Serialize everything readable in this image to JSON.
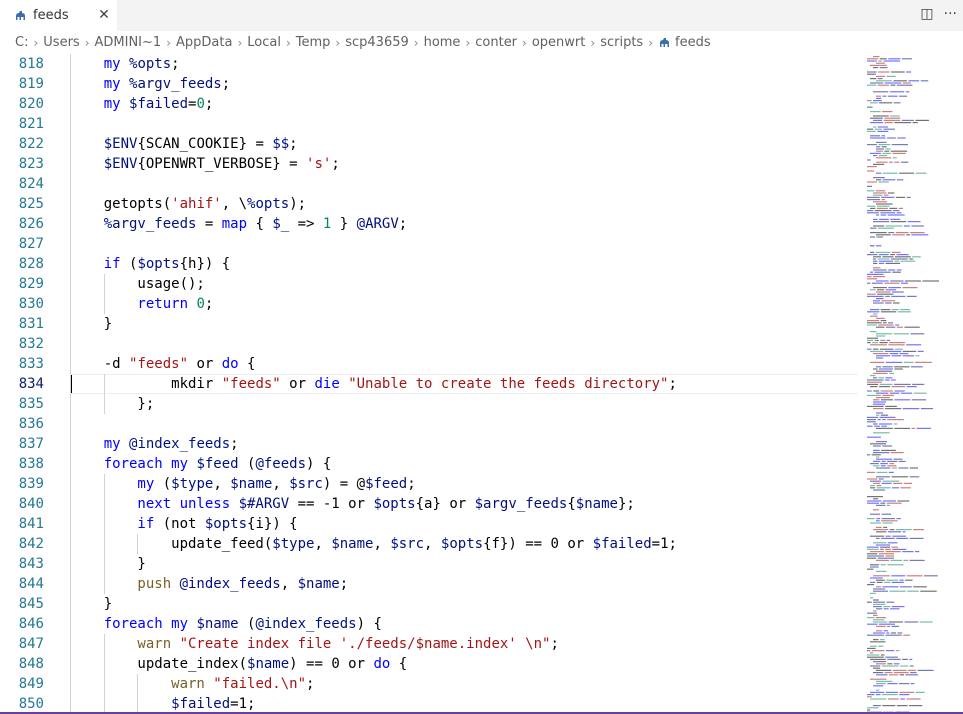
{
  "tab": {
    "label": "feeds",
    "close_glyph": "✕",
    "icon": "perl-camel-icon"
  },
  "actions": {
    "split_glyph": "◫",
    "more_glyph": "···"
  },
  "breadcrumb": [
    "C:",
    "Users",
    "ADMINI~1",
    "AppData",
    "Local",
    "Temp",
    "scp43659",
    "home",
    "conter",
    "openwrt",
    "scripts",
    "feeds"
  ],
  "breadcrumb_separator": "›",
  "cursor_line": 834,
  "lines": [
    {
      "n": "818",
      "t": [
        [
          "    my ",
          "kw"
        ],
        [
          "%opts",
          "var"
        ],
        [
          ";",
          "plain"
        ]
      ]
    },
    {
      "n": "819",
      "t": [
        [
          "    my ",
          "kw"
        ],
        [
          "%argv_feeds",
          "var"
        ],
        [
          ";",
          "plain"
        ]
      ]
    },
    {
      "n": "820",
      "t": [
        [
          "    my ",
          "kw"
        ],
        [
          "$failed",
          "var"
        ],
        [
          "=",
          "plain"
        ],
        [
          "0",
          "num"
        ],
        [
          ";",
          "plain"
        ]
      ]
    },
    {
      "n": "821",
      "t": []
    },
    {
      "n": "822",
      "t": [
        [
          "    $ENV",
          "var"
        ],
        [
          "{SCAN_COOKIE}",
          "plain"
        ],
        [
          " = ",
          "plain"
        ],
        [
          "$$",
          "var"
        ],
        [
          ";",
          "plain"
        ]
      ]
    },
    {
      "n": "823",
      "t": [
        [
          "    $ENV",
          "var"
        ],
        [
          "{OPENWRT_VERBOSE}",
          "plain"
        ],
        [
          " = ",
          "plain"
        ],
        [
          "'s'",
          "str"
        ],
        [
          ";",
          "plain"
        ]
      ]
    },
    {
      "n": "824",
      "t": []
    },
    {
      "n": "825",
      "t": [
        [
          "    getopts(",
          "plain"
        ],
        [
          "'ahif'",
          "str"
        ],
        [
          ", \\",
          "plain"
        ],
        [
          "%opts",
          "var"
        ],
        [
          ");",
          "plain"
        ]
      ]
    },
    {
      "n": "826",
      "t": [
        [
          "    %argv_feeds",
          "var"
        ],
        [
          " = ",
          "plain"
        ],
        [
          "map",
          "kw"
        ],
        [
          " { ",
          "plain"
        ],
        [
          "$_",
          "var"
        ],
        [
          " => ",
          "plain"
        ],
        [
          "1",
          "num"
        ],
        [
          " } ",
          "plain"
        ],
        [
          "@ARGV",
          "var"
        ],
        [
          ";",
          "plain"
        ]
      ]
    },
    {
      "n": "827",
      "t": []
    },
    {
      "n": "828",
      "t": [
        [
          "    if",
          "kw"
        ],
        [
          " (",
          "plain"
        ],
        [
          "$opts",
          "var"
        ],
        [
          "{h}",
          "plain"
        ],
        [
          ") {",
          "plain"
        ]
      ]
    },
    {
      "n": "829",
      "t": [
        [
          "        usage();",
          "plain"
        ]
      ]
    },
    {
      "n": "830",
      "t": [
        [
          "        return ",
          "kw"
        ],
        [
          "0",
          "num"
        ],
        [
          ";",
          "plain"
        ]
      ]
    },
    {
      "n": "831",
      "t": [
        [
          "    }",
          "plain"
        ]
      ]
    },
    {
      "n": "832",
      "t": []
    },
    {
      "n": "833",
      "t": [
        [
          "    -d ",
          "plain"
        ],
        [
          "\"feeds\"",
          "str"
        ],
        [
          " or ",
          "plain"
        ],
        [
          "do",
          "kw"
        ],
        [
          " {",
          "plain"
        ]
      ]
    },
    {
      "n": "834",
      "t": [
        [
          "            mkdir ",
          "plain"
        ],
        [
          "\"feeds\"",
          "str"
        ],
        [
          " or ",
          "plain"
        ],
        [
          "die ",
          "kw"
        ],
        [
          "\"Unable to create the feeds directory\"",
          "str"
        ],
        [
          ";",
          "plain"
        ]
      ]
    },
    {
      "n": "835",
      "t": [
        [
          "        };",
          "plain"
        ]
      ]
    },
    {
      "n": "836",
      "t": []
    },
    {
      "n": "837",
      "t": [
        [
          "    my ",
          "kw"
        ],
        [
          "@index_feeds",
          "var"
        ],
        [
          ";",
          "plain"
        ]
      ]
    },
    {
      "n": "838",
      "t": [
        [
          "    foreach my ",
          "kw"
        ],
        [
          "$feed",
          "var"
        ],
        [
          " (",
          "plain"
        ],
        [
          "@feeds",
          "var"
        ],
        [
          ") {",
          "plain"
        ]
      ]
    },
    {
      "n": "839",
      "t": [
        [
          "        my ",
          "kw"
        ],
        [
          "(",
          "plain"
        ],
        [
          "$type",
          "var"
        ],
        [
          ", ",
          "plain"
        ],
        [
          "$name",
          "var"
        ],
        [
          ", ",
          "plain"
        ],
        [
          "$src",
          "var"
        ],
        [
          ") = @",
          "plain"
        ],
        [
          "$feed",
          "var"
        ],
        [
          ";",
          "plain"
        ]
      ]
    },
    {
      "n": "840",
      "t": [
        [
          "        next unless ",
          "kw"
        ],
        [
          "$#ARGV",
          "var"
        ],
        [
          " == -1 or ",
          "plain"
        ],
        [
          "$opts",
          "var"
        ],
        [
          "{a}",
          "plain"
        ],
        [
          " or ",
          "plain"
        ],
        [
          "$argv_feeds",
          "var"
        ],
        [
          "{",
          "plain"
        ],
        [
          "$name",
          "var"
        ],
        [
          "};",
          "plain"
        ]
      ]
    },
    {
      "n": "841",
      "t": [
        [
          "        if",
          "kw"
        ],
        [
          " (not ",
          "plain"
        ],
        [
          "$opts",
          "var"
        ],
        [
          "{i}",
          "plain"
        ],
        [
          ") {",
          "plain"
        ]
      ]
    },
    {
      "n": "842",
      "t": [
        [
          "            update_feed(",
          "plain"
        ],
        [
          "$type",
          "var"
        ],
        [
          ", ",
          "plain"
        ],
        [
          "$name",
          "var"
        ],
        [
          ", ",
          "plain"
        ],
        [
          "$src",
          "var"
        ],
        [
          ", ",
          "plain"
        ],
        [
          "$opts",
          "var"
        ],
        [
          "{f}) == 0 or ",
          "plain"
        ],
        [
          "$failed",
          "var"
        ],
        [
          "=1;",
          "plain"
        ]
      ]
    },
    {
      "n": "843",
      "t": [
        [
          "        }",
          "plain"
        ]
      ]
    },
    {
      "n": "844",
      "t": [
        [
          "        push ",
          "fn"
        ],
        [
          "@index_feeds",
          "var"
        ],
        [
          ", ",
          "plain"
        ],
        [
          "$name",
          "var"
        ],
        [
          ";",
          "plain"
        ]
      ]
    },
    {
      "n": "845",
      "t": [
        [
          "    }",
          "plain"
        ]
      ]
    },
    {
      "n": "846",
      "t": [
        [
          "    foreach my ",
          "kw"
        ],
        [
          "$name",
          "var"
        ],
        [
          " (",
          "plain"
        ],
        [
          "@index_feeds",
          "var"
        ],
        [
          ") {",
          "plain"
        ]
      ]
    },
    {
      "n": "847",
      "t": [
        [
          "        warn ",
          "fn"
        ],
        [
          "\"Create index file './feeds/$name.index' \\n\"",
          "str"
        ],
        [
          ";",
          "plain"
        ]
      ]
    },
    {
      "n": "848",
      "t": [
        [
          "        update_index(",
          "plain"
        ],
        [
          "$name",
          "var"
        ],
        [
          ") == 0 or ",
          "plain"
        ],
        [
          "do",
          "kw"
        ],
        [
          " {",
          "plain"
        ]
      ]
    },
    {
      "n": "849",
      "t": [
        [
          "            warn ",
          "fn"
        ],
        [
          "\"failed.\\n\"",
          "str"
        ],
        [
          ";",
          "plain"
        ]
      ]
    },
    {
      "n": "850",
      "t": [
        [
          "            $failed",
          "var"
        ],
        [
          "=1;",
          "plain"
        ]
      ]
    }
  ]
}
